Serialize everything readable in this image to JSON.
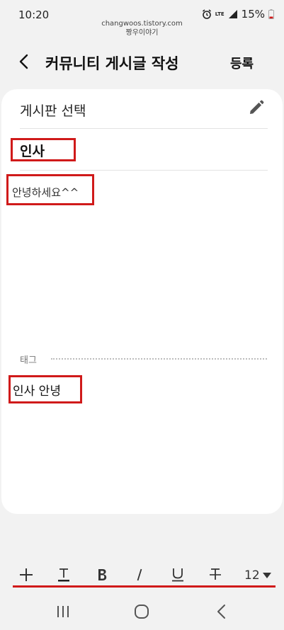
{
  "status": {
    "time": "10:20",
    "network": "LTE",
    "battery": "15%"
  },
  "watermark": {
    "line1": "changwoos.tistory.com",
    "line2": "짱우이야기"
  },
  "header": {
    "title": "커뮤니티 게시글 작성",
    "register_label": "등록"
  },
  "form": {
    "board_select_label": "게시판 선택",
    "title_value": "인사",
    "body_value": "안녕하세요^^",
    "tag_label": "태그",
    "tag_value": "인사 안녕"
  },
  "toolbar": {
    "font_size": "12"
  },
  "colors": {
    "highlight": "#d01a1a",
    "card": "#ffffff",
    "background": "#f2f2f2"
  }
}
